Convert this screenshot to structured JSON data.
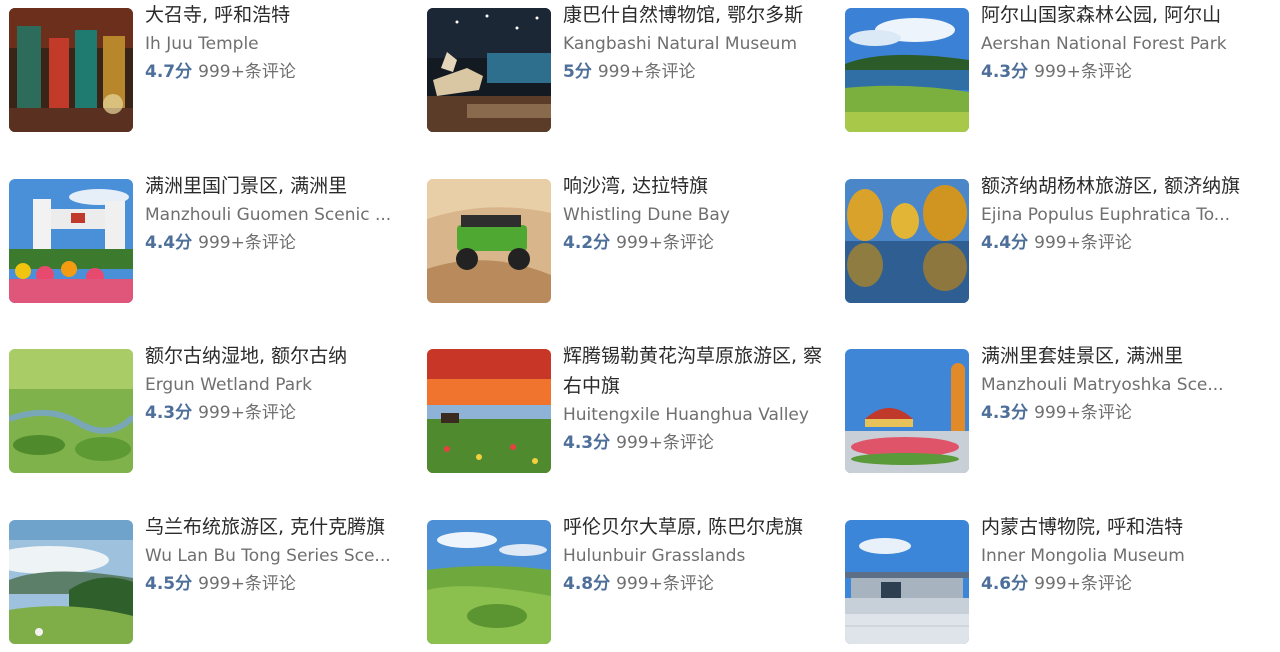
{
  "attractions": [
    {
      "title": "大召寺, 呼和浩特",
      "subtitle": "Ih Juu Temple",
      "score": "4.7分",
      "reviews": "999+条评论",
      "thumb_icon": "temple-photo"
    },
    {
      "title": "康巴什自然博物馆, 鄂尔多斯",
      "subtitle": "Kangbashi Natural Museum",
      "score": "5分",
      "reviews": "999+条评论",
      "thumb_icon": "museum-photo"
    },
    {
      "title": "阿尔山国家森林公园, 阿尔山",
      "subtitle": "Aershan National Forest Park",
      "score": "4.3分",
      "reviews": "999+条评论",
      "thumb_icon": "lake-forest-photo"
    },
    {
      "title": "满洲里国门景区, 满洲里",
      "subtitle": "Manzhouli Guomen Scenic ...",
      "score": "4.4分",
      "reviews": "999+条评论",
      "thumb_icon": "gate-flowers-photo"
    },
    {
      "title": "响沙湾, 达拉特旗",
      "subtitle": "Whistling Dune Bay",
      "score": "4.2分",
      "reviews": "999+条评论",
      "thumb_icon": "desert-vehicle-photo"
    },
    {
      "title": "额济纳胡杨林旅游区, 额济纳旗",
      "subtitle": "Ejina Populus Euphratica To...",
      "score": "4.4分",
      "reviews": "999+条评论",
      "thumb_icon": "autumn-trees-photo"
    },
    {
      "title": "额尔古纳湿地, 额尔古纳",
      "subtitle": "Ergun Wetland Park",
      "score": "4.3分",
      "reviews": "999+条评论",
      "thumb_icon": "wetland-photo"
    },
    {
      "title": "辉腾锡勒黄花沟草原旅游区, 察右中旗",
      "subtitle": "Huitengxile Huanghua Valley",
      "score": "4.3分",
      "reviews": "999+条评论",
      "thumb_icon": "sunset-grassland-photo"
    },
    {
      "title": "满洲里套娃景区, 满洲里",
      "subtitle": "Manzhouli Matryoshka Sce...",
      "score": "4.3分",
      "reviews": "999+条评论",
      "thumb_icon": "matryoshka-park-photo"
    },
    {
      "title": "乌兰布统旅游区, 克什克腾旗",
      "subtitle": "Wu Lan Bu Tong Series Sce...",
      "score": "4.5分",
      "reviews": "999+条评论",
      "thumb_icon": "misty-hills-photo"
    },
    {
      "title": "呼伦贝尔大草原, 陈巴尔虎旗",
      "subtitle": "Hulunbuir Grasslands",
      "score": "4.8分",
      "reviews": "999+条评论",
      "thumb_icon": "grassland-photo"
    },
    {
      "title": "内蒙古博物院, 呼和浩特",
      "subtitle": "Inner Mongolia Museum",
      "score": "4.6分",
      "reviews": "999+条评论",
      "thumb_icon": "museum-building-photo"
    }
  ],
  "colors": {
    "score": "#4d6f99",
    "title": "#2b2b2b",
    "muted": "#6f6f6f"
  }
}
